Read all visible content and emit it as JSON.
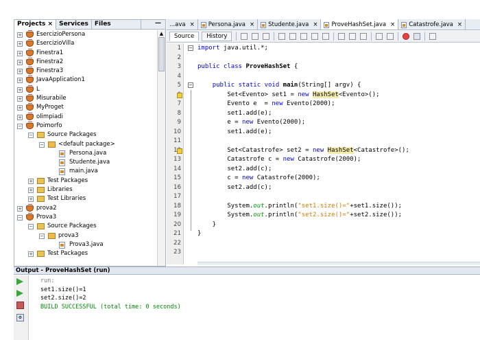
{
  "left_panel": {
    "tabs": [
      "Projects",
      "Services",
      "Files"
    ],
    "close_glyph": "×",
    "minimize_glyph": "—",
    "tree": [
      {
        "label": "EsercizioPersona",
        "level": 0,
        "icon": "coffee-cup-icon",
        "expander": "+"
      },
      {
        "label": "EsercizioVilla",
        "level": 0,
        "icon": "coffee-cup-icon",
        "expander": "+"
      },
      {
        "label": "Finestra1",
        "level": 0,
        "icon": "coffee-cup-icon",
        "expander": "+"
      },
      {
        "label": "Finestra2",
        "level": 0,
        "icon": "coffee-cup-icon",
        "expander": "+"
      },
      {
        "label": "Finestra3",
        "level": 0,
        "icon": "coffee-cup-icon",
        "expander": "+"
      },
      {
        "label": "JavaApplication1",
        "level": 0,
        "icon": "coffee-cup-icon",
        "expander": "+"
      },
      {
        "label": "L",
        "level": 0,
        "icon": "coffee-cup-icon",
        "expander": "+"
      },
      {
        "label": "Misurabile",
        "level": 0,
        "icon": "coffee-cup-icon",
        "expander": "+"
      },
      {
        "label": "MyProget",
        "level": 0,
        "icon": "coffee-cup-icon",
        "expander": "+"
      },
      {
        "label": "olimpiadi",
        "level": 0,
        "icon": "coffee-cup-icon",
        "expander": "+"
      },
      {
        "label": "Poimorfo",
        "level": 0,
        "icon": "coffee-cup-icon",
        "expander": "−"
      },
      {
        "label": "Source Packages",
        "level": 1,
        "icon": "folder-icon",
        "expander": "−"
      },
      {
        "label": "<default package>",
        "level": 2,
        "icon": "package-icon",
        "expander": "−"
      },
      {
        "label": "Persona.java",
        "level": 3,
        "icon": "java-file-icon",
        "expander": ""
      },
      {
        "label": "Studente.java",
        "level": 3,
        "icon": "java-file-icon",
        "expander": ""
      },
      {
        "label": "main.java",
        "level": 3,
        "icon": "java-file-icon",
        "expander": ""
      },
      {
        "label": "Test Packages",
        "level": 1,
        "icon": "folder-icon",
        "expander": "+"
      },
      {
        "label": "Libraries",
        "level": 1,
        "icon": "folder-icon",
        "expander": "+"
      },
      {
        "label": "Test Libraries",
        "level": 1,
        "icon": "folder-icon",
        "expander": "+"
      },
      {
        "label": "prova2",
        "level": 0,
        "icon": "coffee-cup-icon",
        "expander": "+"
      },
      {
        "label": "Prova3",
        "level": 0,
        "icon": "coffee-cup-icon",
        "expander": "−"
      },
      {
        "label": "Source Packages",
        "level": 1,
        "icon": "folder-icon",
        "expander": "−"
      },
      {
        "label": "prova3",
        "level": 2,
        "icon": "package-icon",
        "expander": "−"
      },
      {
        "label": "Prova3.java",
        "level": 3,
        "icon": "java-file-icon",
        "expander": ""
      },
      {
        "label": "Test Packages",
        "level": 1,
        "icon": "folder-icon",
        "expander": "+"
      }
    ]
  },
  "editor": {
    "tabs": [
      {
        "label": "...ava",
        "icon": "",
        "close": "×"
      },
      {
        "label": "Persona.java",
        "icon": "java-file-icon",
        "close": "×"
      },
      {
        "label": "Studente.java",
        "icon": "java-file-icon",
        "close": "×"
      },
      {
        "label": "ProveHashSet.java",
        "icon": "java-file-icon",
        "close": "×",
        "active": true
      },
      {
        "label": "Catastrofe.java",
        "icon": "java-file-icon",
        "close": "×"
      }
    ],
    "toolbar": {
      "source_label": "Source",
      "history_label": "History"
    },
    "lines": [
      {
        "n": "1",
        "html": "<span class=\"kw\">import</span> java.util.*;"
      },
      {
        "n": "2",
        "html": ""
      },
      {
        "n": "3",
        "html": "<span class=\"kw\">public</span> <span class=\"kw\">class</span> <span class=\"b\">ProveHashSet</span> {"
      },
      {
        "n": "4",
        "html": ""
      },
      {
        "n": "5",
        "html": "    <span class=\"kw\">public</span> <span class=\"kw\">static</span> <span class=\"kw\">void</span> <span class=\"b\">main</span>(String[] argv) {"
      },
      {
        "n": "6",
        "html": "        Set&lt;Evento&gt; set1 = <span class=\"kw\">new</span> <span class=\"hl\">HashSet</span>&lt;Evento&gt;();"
      },
      {
        "n": "7",
        "html": "        Evento e  = <span class=\"kw\">new</span> Evento(2000);"
      },
      {
        "n": "8",
        "html": "        set1.add(e);"
      },
      {
        "n": "9",
        "html": "        e = <span class=\"kw\">new</span> Evento(2000);"
      },
      {
        "n": "10",
        "html": "        set1.add(e);"
      },
      {
        "n": "11",
        "html": ""
      },
      {
        "n": "12",
        "html": "        Set&lt;Catastrofe&gt; set2 = <span class=\"kw\">new</span> <span class=\"hl\">HashSet</span>&lt;Catastrofe&gt;();"
      },
      {
        "n": "13",
        "html": "        Catastrofe c = <span class=\"kw\">new</span> Catastrofe(2000);"
      },
      {
        "n": "14",
        "html": "        set2.add(c);"
      },
      {
        "n": "15",
        "html": "        c = <span class=\"kw\">new</span> Catastrofe(2000);"
      },
      {
        "n": "16",
        "html": "        set2.add(c);"
      },
      {
        "n": "17",
        "html": ""
      },
      {
        "n": "18",
        "html": "        System.<span class=\"fld\">out</span>.println(<span class=\"str\">\"set1.size()=\"</span>+set1.size());"
      },
      {
        "n": "19",
        "html": "        System.<span class=\"fld\">out</span>.println(<span class=\"str\">\"set2.size()=\"</span>+set2.size());"
      },
      {
        "n": "20",
        "html": "    }"
      },
      {
        "n": "21",
        "html": "}"
      },
      {
        "n": "22",
        "html": ""
      },
      {
        "n": "23",
        "html": ""
      }
    ]
  },
  "output": {
    "title": "Output - ProveHashSet (run)",
    "lines": [
      {
        "text": "run:",
        "style": "grey"
      },
      {
        "text": "set1.size()=1",
        "style": ""
      },
      {
        "text": "set2.size()=2",
        "style": ""
      },
      {
        "text": "BUILD SUCCESSFUL (total time: 0 seconds)",
        "style": "green"
      }
    ]
  }
}
